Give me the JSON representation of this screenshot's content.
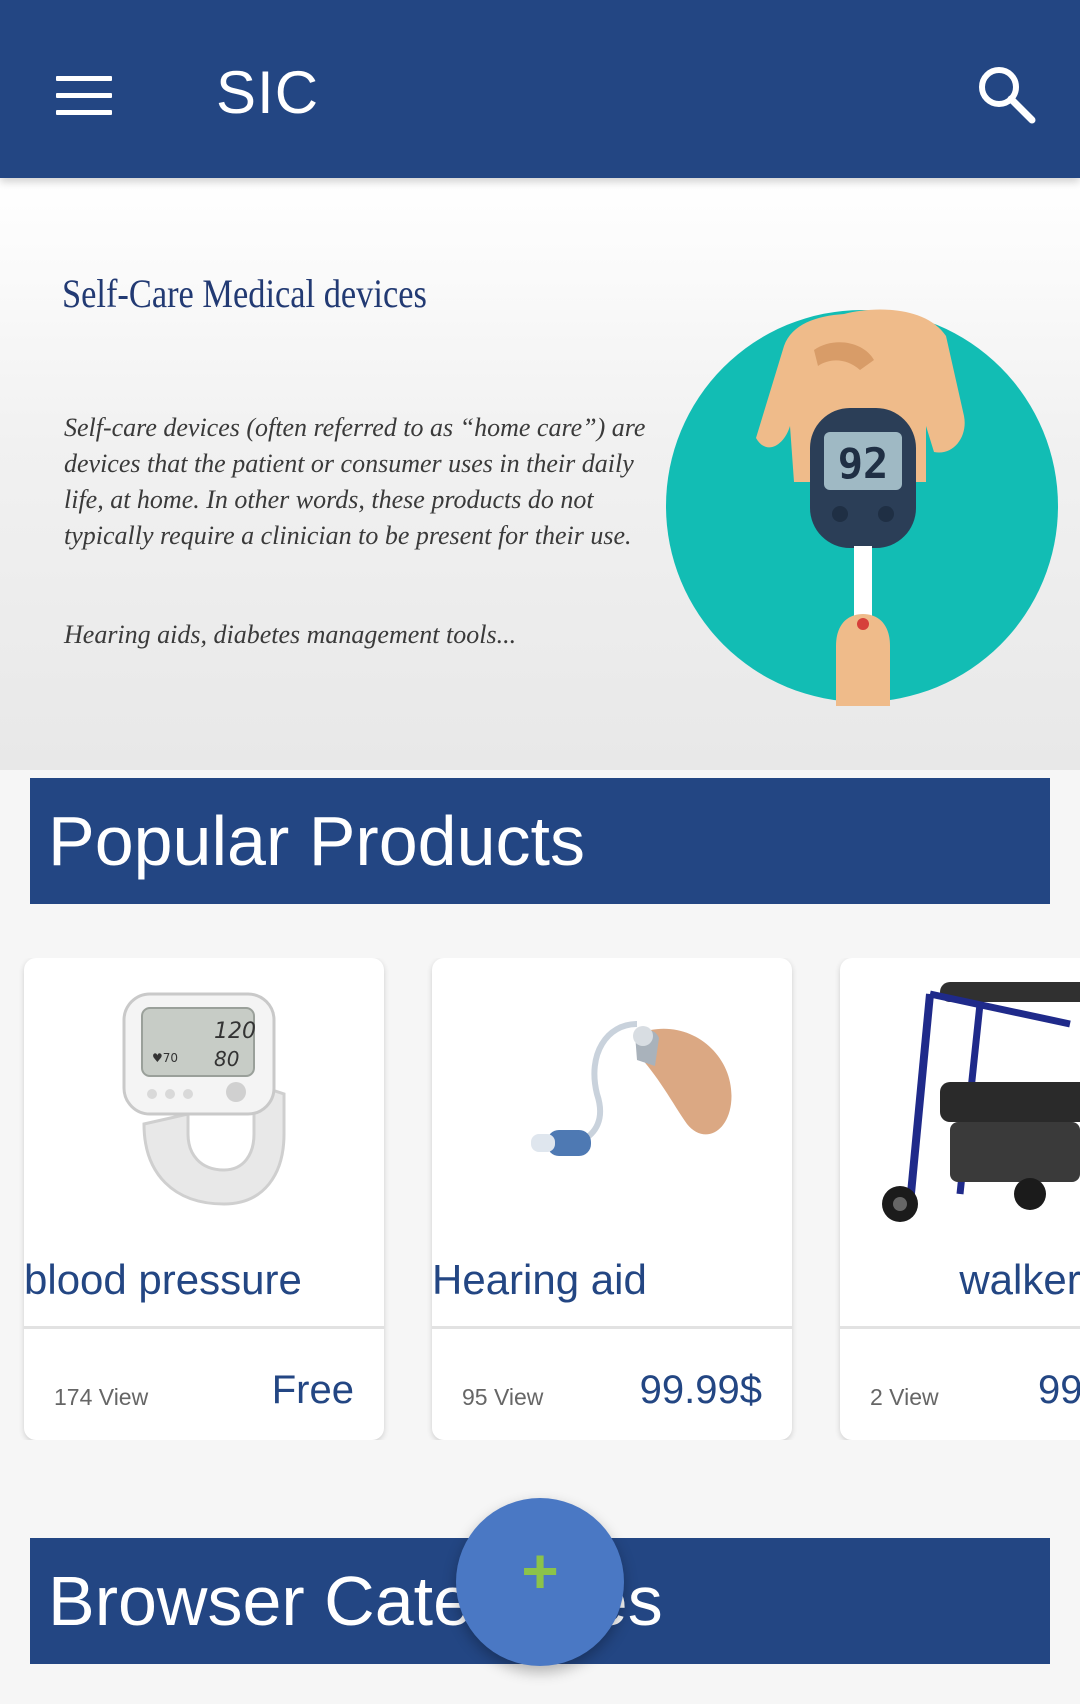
{
  "appbar": {
    "title": "SIC",
    "color": "#234683",
    "menu_icon": "menu-icon",
    "search_icon": "search-icon"
  },
  "banner": {
    "title": "Self-Care Medical devices",
    "body": "Self-care devices (often referred to as “home care”) are devices that the patient or consumer uses in their daily life, at home. In other words, these products do not typically require a clinician to be present for their use.",
    "note": "Hearing aids, diabetes management tools...",
    "meter_reading": "92"
  },
  "sections": {
    "popular": "Popular Products",
    "browse": "Browser Categories"
  },
  "products": [
    {
      "name": "blood pressure",
      "views": "174 View",
      "price": "Free",
      "image": "blood-pressure-monitor",
      "name_align": "left"
    },
    {
      "name": "Hearing aid",
      "views": "95 View",
      "price": "99.99$",
      "image": "hearing-aid",
      "name_align": "left"
    },
    {
      "name": "walker",
      "views": "2 View",
      "price": "99",
      "image": "rollator-walker",
      "name_align": "center"
    }
  ],
  "fab": {
    "label": "+",
    "icon": "plus-icon",
    "color": "#4a78c4"
  }
}
